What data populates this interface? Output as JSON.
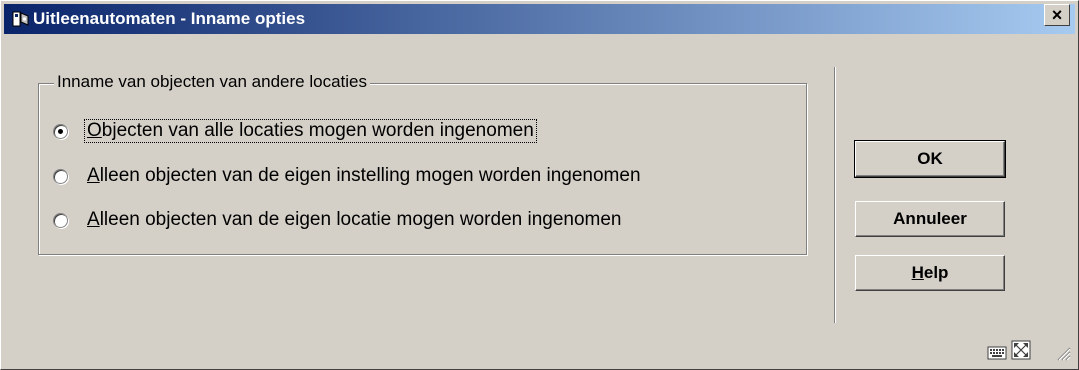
{
  "window": {
    "title": "Uitleenautomaten - Inname opties",
    "close_label": "×"
  },
  "group": {
    "legend": "Inname van objecten van andere locaties",
    "options": [
      {
        "accesskey": "O",
        "rest": "bjecten van alle locaties mogen worden ingenomen",
        "checked": true
      },
      {
        "accesskey": "A",
        "rest": "lleen objecten van de eigen instelling mogen worden ingenomen",
        "checked": false
      },
      {
        "accesskey": "A",
        "rest": "lleen objecten van de eigen locatie mogen worden ingenomen",
        "checked": false
      }
    ]
  },
  "buttons": {
    "ok": "OK",
    "cancel": "Annuleer",
    "help_accesskey": "H",
    "help_rest": "elp"
  },
  "statusbar": {
    "icons": [
      "keyboard-icon",
      "fullscreen-icon",
      "resize-grip-icon"
    ]
  },
  "colors": {
    "titlebar_start": "#0a246a",
    "titlebar_end": "#a6caf0",
    "face": "#d4d0c8"
  }
}
